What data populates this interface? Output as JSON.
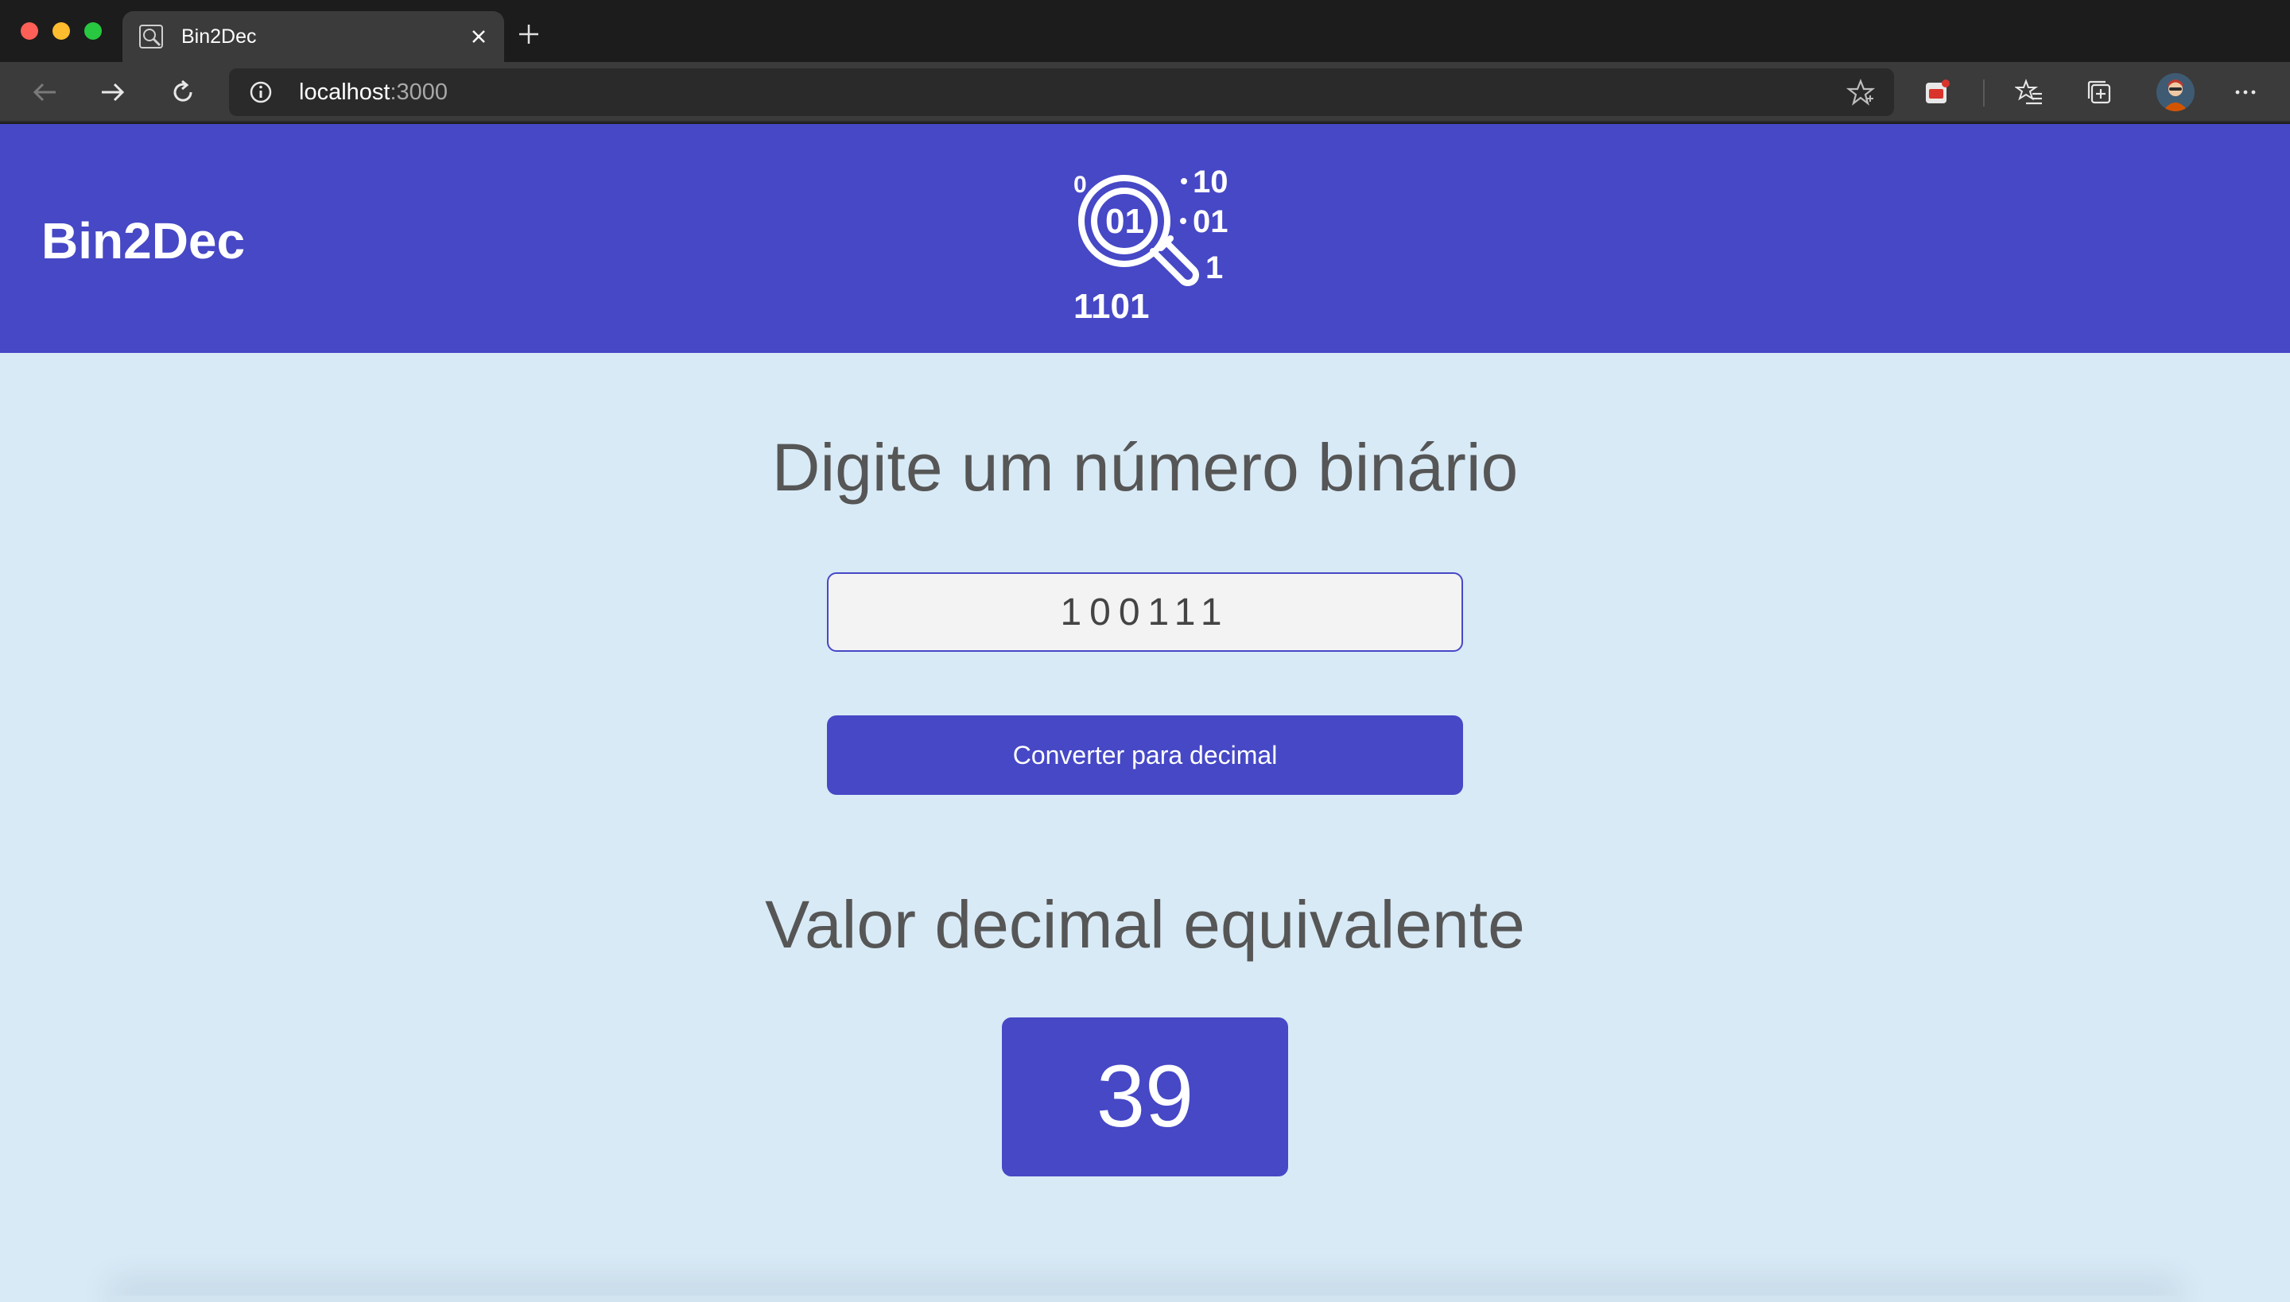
{
  "browser": {
    "tab_title": "Bin2Dec",
    "url_host": "localhost",
    "url_port": ":3000"
  },
  "header": {
    "brand": "Bin2Dec",
    "logo_icon": "binary-magnifier-icon"
  },
  "main": {
    "input_heading": "Digite um número binário",
    "input_value": "100111",
    "convert_label": "Converter para decimal",
    "result_heading": "Valor decimal equivalente",
    "result_value": "39"
  },
  "colors": {
    "primary": "#4648c6",
    "background": "#d8eaf6",
    "heading_text": "#565656"
  }
}
